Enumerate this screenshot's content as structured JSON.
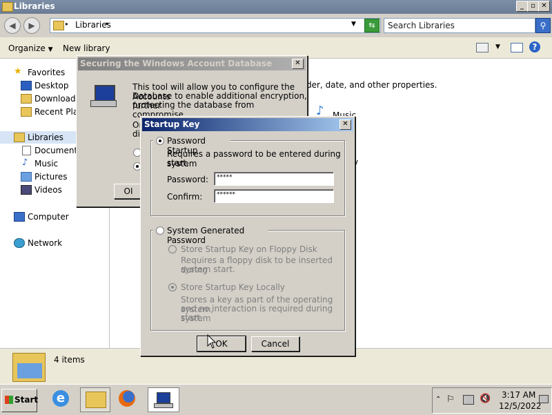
{
  "window": {
    "title": "Libraries",
    "minimize": "_",
    "maximize": "▫",
    "close": "✕"
  },
  "address": {
    "path": "Libraries",
    "search_placeholder": "Search Libraries"
  },
  "toolbar": {
    "organize": "Organize",
    "new_library": "New library"
  },
  "nav": {
    "favorites": "Favorites",
    "desktop": "Desktop",
    "downloads": "Downloads",
    "recent": "Recent Places",
    "libraries": "Libraries",
    "documents": "Documents",
    "music": "Music",
    "pictures": "Pictures",
    "videos": "Videos",
    "computer": "Computer",
    "network": "Network"
  },
  "content": {
    "partial_description": "der, date, and other properties.",
    "partial_music": "Music",
    "partial_y": "y"
  },
  "details": {
    "count": "4 items"
  },
  "security_dialog": {
    "title": "Securing the Windows Account Database",
    "line1": "This tool will allow you to configure the Accounts",
    "line2": "Database to enable additional encryption, further",
    "line3": "protecting the database from compromise.",
    "partial_1": "Or",
    "partial_2": "dis",
    "partial_ok": "OI"
  },
  "startup_dialog": {
    "title": "Startup Key",
    "password_startup": "Password Startup",
    "ps_desc1": "Requires a password to be entered during system",
    "ps_desc2": "start.",
    "password_label": "Password:",
    "password_value": "*****",
    "confirm_label": "Confirm:",
    "confirm_value": "******",
    "system_generated": "System Generated Password",
    "floppy": "Store Startup Key on Floppy Disk",
    "floppy_desc1": "Requires a floppy disk to be inserted during",
    "floppy_desc2": "system start.",
    "locally": "Store Startup Key Locally",
    "local_desc1": "Stores a key as part of the operating system,",
    "local_desc2": "and no interaction is required during system",
    "local_desc3": "start.",
    "ok": "OK",
    "cancel": "Cancel"
  },
  "taskbar": {
    "start": "Start",
    "time": "3:17 AM",
    "date": "12/5/2022"
  }
}
